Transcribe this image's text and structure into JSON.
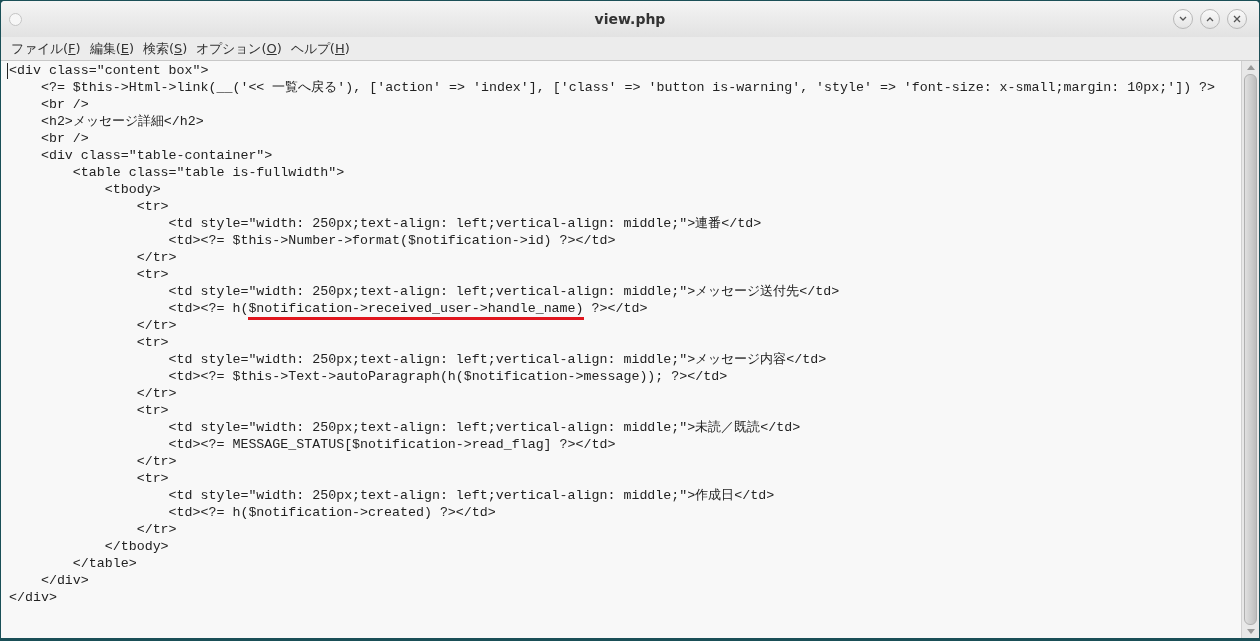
{
  "window": {
    "title": "view.php"
  },
  "menu": [
    {
      "parts": [
        {
          "text": "ファイル("
        },
        {
          "text": "F",
          "underlined": true
        },
        {
          "text": ")"
        }
      ]
    },
    {
      "parts": [
        {
          "text": "編集("
        },
        {
          "text": "E",
          "underlined": true
        },
        {
          "text": ")"
        }
      ]
    },
    {
      "parts": [
        {
          "text": "検索("
        },
        {
          "text": "S",
          "underlined": true
        },
        {
          "text": ")"
        }
      ]
    },
    {
      "parts": [
        {
          "text": "オプション("
        },
        {
          "text": "O",
          "underlined": true
        },
        {
          "text": ")"
        }
      ]
    },
    {
      "parts": [
        {
          "text": "ヘルプ("
        },
        {
          "text": "H",
          "underlined": true
        },
        {
          "text": ")"
        }
      ]
    }
  ],
  "editor": {
    "lines": [
      {
        "parts": [
          {
            "text": "<div class=\"content box\">"
          }
        ]
      },
      {
        "parts": [
          {
            "text": "    <?= $this->Html->link(__('<< 一覧へ戻る'), ['action' => 'index'], ['class' => 'button is-warning', 'style' => 'font-size: x-small;margin: 10px;']) ?>"
          }
        ]
      },
      {
        "parts": [
          {
            "text": "    <br />"
          }
        ]
      },
      {
        "parts": [
          {
            "text": "    <h2>メッセージ詳細</h2>"
          }
        ]
      },
      {
        "parts": [
          {
            "text": "    <br />"
          }
        ]
      },
      {
        "parts": [
          {
            "text": "    <div class=\"table-container\">"
          }
        ]
      },
      {
        "parts": [
          {
            "text": "        <table class=\"table is-fullwidth\">"
          }
        ]
      },
      {
        "parts": [
          {
            "text": "            <tbody>"
          }
        ]
      },
      {
        "parts": [
          {
            "text": "                <tr>"
          }
        ]
      },
      {
        "parts": [
          {
            "text": "                    <td style=\"width: 250px;text-align: left;vertical-align: middle;\">連番</td>"
          }
        ]
      },
      {
        "parts": [
          {
            "text": "                    <td><?= $this->Number->format($notification->id) ?></td>"
          }
        ]
      },
      {
        "parts": [
          {
            "text": "                </tr>"
          }
        ]
      },
      {
        "parts": [
          {
            "text": "                <tr>"
          }
        ]
      },
      {
        "parts": [
          {
            "text": "                    <td style=\"width: 250px;text-align: left;vertical-align: middle;\">メッセージ送付先</td>"
          }
        ]
      },
      {
        "parts": [
          {
            "text": "                    <td><?= h("
          },
          {
            "text": "$notification->received_user->handle_name)",
            "underlined": true
          },
          {
            "text": " ?></td>"
          }
        ]
      },
      {
        "parts": [
          {
            "text": "                </tr>"
          }
        ]
      },
      {
        "parts": [
          {
            "text": "                <tr>"
          }
        ]
      },
      {
        "parts": [
          {
            "text": "                    <td style=\"width: 250px;text-align: left;vertical-align: middle;\">メッセージ内容</td>"
          }
        ]
      },
      {
        "parts": [
          {
            "text": "                    <td><?= $this->Text->autoParagraph(h($notification->message)); ?></td>"
          }
        ]
      },
      {
        "parts": [
          {
            "text": "                </tr>"
          }
        ]
      },
      {
        "parts": [
          {
            "text": "                <tr>"
          }
        ]
      },
      {
        "parts": [
          {
            "text": "                    <td style=\"width: 250px;text-align: left;vertical-align: middle;\">未読／既読</td>"
          }
        ]
      },
      {
        "parts": [
          {
            "text": "                    <td><?= MESSAGE_STATUS[$notification->read_flag] ?></td>"
          }
        ]
      },
      {
        "parts": [
          {
            "text": "                </tr>"
          }
        ]
      },
      {
        "parts": [
          {
            "text": "                <tr>"
          }
        ]
      },
      {
        "parts": [
          {
            "text": "                    <td style=\"width: 250px;text-align: left;vertical-align: middle;\">作成日</td>"
          }
        ]
      },
      {
        "parts": [
          {
            "text": "                    <td><?= h($notification->created) ?></td>"
          }
        ]
      },
      {
        "parts": [
          {
            "text": "                </tr>"
          }
        ]
      },
      {
        "parts": [
          {
            "text": "            </tbody>"
          }
        ]
      },
      {
        "parts": [
          {
            "text": "        </table>"
          }
        ]
      },
      {
        "parts": [
          {
            "text": "    </div>"
          }
        ]
      },
      {
        "parts": [
          {
            "text": "</div>"
          }
        ]
      }
    ]
  }
}
